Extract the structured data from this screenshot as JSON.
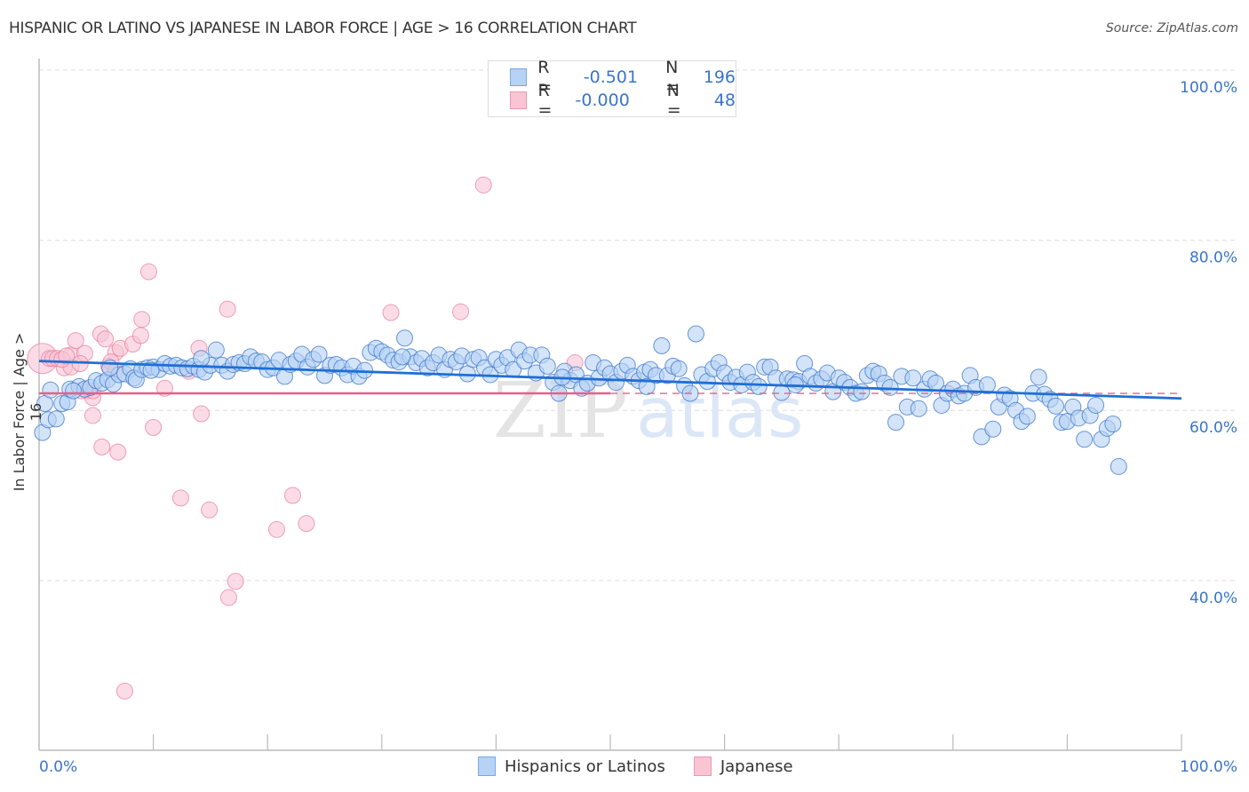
{
  "title": "HISPANIC OR LATINO VS JAPANESE IN LABOR FORCE | AGE > 16 CORRELATION CHART",
  "source": "Source: ZipAtlas.com",
  "colors": {
    "blue": "#3a74c9",
    "blue_fill": "#b6d2f5",
    "blue_line": "#1f6fd6",
    "pink": "#e8799b",
    "pink_fill": "#f9c5d5",
    "pink_line": "#e5608a",
    "grid": "#dddddd",
    "axis": "#bbbbbb"
  },
  "legend_top": [
    {
      "r_label": "R =",
      "r_value": "-0.501",
      "n_label": "N =",
      "n_value": "196"
    },
    {
      "r_label": "R =",
      "r_value": "-0.000",
      "n_label": "N =",
      "n_value": "48"
    }
  ],
  "chart_data": {
    "type": "scatter",
    "title": "HISPANIC OR LATINO VS JAPANESE IN LABOR FORCE | AGE > 16 CORRELATION CHART",
    "xlabel": "",
    "ylabel": "In Labor Force | Age > 16",
    "xlim": [
      0,
      100
    ],
    "ylim": [
      20,
      102
    ],
    "x_tick_labels": [
      "0.0%",
      "100.0%"
    ],
    "x_minor_ticks": [
      10,
      20,
      30,
      40,
      50,
      60,
      70,
      80,
      90,
      100
    ],
    "y_ticks": [
      100,
      80,
      60,
      40
    ],
    "y_tick_labels": [
      "100.0%",
      "80.0%",
      "60.0%",
      "40.0%"
    ],
    "grid": true,
    "legend_position": "bottom-center",
    "watermark": "ZIPatlas",
    "series": [
      {
        "name": "Hispanics or Latinos",
        "r": -0.501,
        "n": 196,
        "trend": {
          "x": [
            0,
            100
          ],
          "y": [
            65.8,
            61.4
          ]
        },
        "points": [
          [
            0.3,
            57.4
          ],
          [
            0.8,
            58.9
          ],
          [
            1.5,
            59.0
          ],
          [
            2.0,
            60.8
          ],
          [
            2.5,
            61.0
          ],
          [
            2.7,
            62.5
          ],
          [
            3.5,
            62.8
          ],
          [
            4.0,
            62.5
          ],
          [
            4.5,
            62.7
          ],
          [
            5.0,
            63.5
          ],
          [
            5.5,
            63.2
          ],
          [
            6.0,
            63.6
          ],
          [
            6.5,
            63.1
          ],
          [
            7.0,
            64.2
          ],
          [
            7.5,
            64.3
          ],
          [
            8.0,
            64.9
          ],
          [
            8.3,
            63.8
          ],
          [
            8.5,
            63.6
          ],
          [
            9.0,
            64.8
          ],
          [
            9.5,
            65.0
          ],
          [
            10.0,
            65.1
          ],
          [
            10.5,
            64.8
          ],
          [
            11.0,
            65.5
          ],
          [
            11.5,
            65.2
          ],
          [
            12.0,
            65.3
          ],
          [
            12.5,
            65.0
          ],
          [
            13.0,
            64.9
          ],
          [
            13.5,
            65.2
          ],
          [
            14.0,
            64.8
          ],
          [
            14.5,
            64.5
          ],
          [
            15.0,
            65.3
          ],
          [
            15.5,
            67.1
          ],
          [
            16.0,
            65.3
          ],
          [
            16.5,
            64.6
          ],
          [
            17.0,
            65.4
          ],
          [
            17.5,
            65.6
          ],
          [
            18.0,
            65.5
          ],
          [
            18.5,
            66.3
          ],
          [
            19.0,
            65.8
          ],
          [
            19.5,
            65.7
          ],
          [
            20.0,
            64.8
          ],
          [
            20.5,
            65.0
          ],
          [
            21.0,
            65.9
          ],
          [
            21.5,
            64.0
          ],
          [
            22.0,
            65.4
          ],
          [
            22.5,
            65.8
          ],
          [
            23.0,
            66.6
          ],
          [
            23.5,
            65.1
          ],
          [
            24.0,
            66.0
          ],
          [
            24.5,
            66.6
          ],
          [
            25.0,
            64.1
          ],
          [
            25.5,
            65.3
          ],
          [
            26.0,
            65.4
          ],
          [
            26.5,
            65.0
          ],
          [
            27.0,
            64.2
          ],
          [
            27.5,
            65.2
          ],
          [
            28.0,
            64.0
          ],
          [
            28.5,
            64.7
          ],
          [
            29.0,
            66.8
          ],
          [
            29.5,
            67.3
          ],
          [
            30.0,
            66.9
          ],
          [
            30.5,
            66.5
          ],
          [
            31.0,
            65.9
          ],
          [
            31.5,
            65.7
          ],
          [
            32.0,
            68.5
          ],
          [
            32.5,
            66.3
          ],
          [
            33.0,
            65.6
          ],
          [
            33.5,
            66.1
          ],
          [
            34.0,
            65.0
          ],
          [
            34.5,
            65.6
          ],
          [
            35.0,
            66.5
          ],
          [
            35.5,
            64.8
          ],
          [
            36.0,
            66.0
          ],
          [
            36.5,
            65.7
          ],
          [
            37.0,
            66.4
          ],
          [
            37.5,
            64.3
          ],
          [
            38.0,
            66.0
          ],
          [
            38.5,
            66.2
          ],
          [
            39.0,
            65.0
          ],
          [
            39.5,
            64.2
          ],
          [
            40.0,
            66.0
          ],
          [
            40.5,
            65.3
          ],
          [
            41.0,
            66.2
          ],
          [
            41.5,
            64.8
          ],
          [
            42.0,
            67.1
          ],
          [
            42.5,
            65.8
          ],
          [
            43.0,
            66.5
          ],
          [
            43.5,
            64.4
          ],
          [
            44.0,
            66.5
          ],
          [
            44.5,
            65.2
          ],
          [
            45.0,
            63.3
          ],
          [
            45.5,
            62.0
          ],
          [
            46.0,
            64.6
          ],
          [
            46.5,
            63.5
          ],
          [
            47.0,
            64.2
          ],
          [
            47.5,
            62.6
          ],
          [
            48.0,
            63.2
          ],
          [
            48.5,
            65.6
          ],
          [
            49.0,
            63.8
          ],
          [
            49.5,
            65.0
          ],
          [
            50.0,
            64.3
          ],
          [
            50.5,
            63.3
          ],
          [
            51.0,
            64.6
          ],
          [
            51.5,
            65.3
          ],
          [
            52.0,
            64.0
          ],
          [
            52.5,
            63.5
          ],
          [
            53.0,
            64.5
          ],
          [
            53.5,
            64.8
          ],
          [
            54.0,
            64.1
          ],
          [
            54.5,
            67.6
          ],
          [
            55.0,
            64.1
          ],
          [
            55.5,
            65.2
          ],
          [
            56.0,
            64.9
          ],
          [
            56.5,
            62.9
          ],
          [
            57.0,
            62.0
          ],
          [
            57.5,
            69.0
          ],
          [
            58.0,
            64.2
          ],
          [
            58.5,
            63.4
          ],
          [
            59.0,
            64.9
          ],
          [
            59.5,
            65.6
          ],
          [
            60.0,
            64.4
          ],
          [
            60.5,
            63.3
          ],
          [
            61.0,
            63.9
          ],
          [
            61.5,
            63.0
          ],
          [
            62.0,
            64.5
          ],
          [
            62.5,
            63.3
          ],
          [
            63.0,
            62.8
          ],
          [
            63.5,
            65.1
          ],
          [
            64.0,
            65.1
          ],
          [
            64.5,
            63.8
          ],
          [
            65.0,
            62.1
          ],
          [
            65.5,
            63.7
          ],
          [
            66.0,
            63.6
          ],
          [
            66.5,
            63.4
          ],
          [
            67.0,
            65.5
          ],
          [
            67.5,
            64.0
          ],
          [
            68.0,
            63.2
          ],
          [
            68.5,
            63.7
          ],
          [
            69.0,
            64.4
          ],
          [
            69.5,
            62.2
          ],
          [
            70.0,
            63.8
          ],
          [
            70.5,
            63.3
          ],
          [
            71.0,
            62.7
          ],
          [
            71.5,
            62.0
          ],
          [
            72.0,
            62.2
          ],
          [
            72.5,
            64.1
          ],
          [
            73.0,
            64.6
          ],
          [
            73.5,
            64.3
          ],
          [
            74.0,
            63.2
          ],
          [
            74.5,
            62.7
          ],
          [
            75.0,
            58.6
          ],
          [
            75.5,
            64.0
          ],
          [
            76.0,
            60.4
          ],
          [
            76.5,
            63.8
          ],
          [
            77.0,
            60.2
          ],
          [
            77.5,
            62.5
          ],
          [
            78.0,
            63.7
          ],
          [
            78.5,
            63.2
          ],
          [
            79.0,
            60.6
          ],
          [
            79.5,
            62.0
          ],
          [
            80.0,
            62.5
          ],
          [
            80.5,
            61.7
          ],
          [
            81.0,
            62.0
          ],
          [
            81.5,
            64.1
          ],
          [
            82.0,
            62.7
          ],
          [
            82.5,
            56.9
          ],
          [
            83.0,
            63.0
          ],
          [
            83.5,
            57.8
          ],
          [
            84.0,
            60.4
          ],
          [
            84.5,
            61.8
          ],
          [
            85.0,
            61.4
          ],
          [
            85.5,
            60.0
          ],
          [
            86.0,
            58.7
          ],
          [
            86.5,
            59.3
          ],
          [
            87.0,
            62.0
          ],
          [
            87.5,
            63.9
          ],
          [
            88.0,
            61.9
          ],
          [
            88.5,
            61.3
          ],
          [
            89.0,
            60.5
          ],
          [
            89.5,
            58.6
          ],
          [
            90.0,
            58.7
          ],
          [
            90.5,
            60.4
          ],
          [
            91.0,
            59.1
          ],
          [
            91.5,
            56.6
          ],
          [
            92.0,
            59.4
          ],
          [
            92.5,
            60.6
          ],
          [
            93.0,
            56.6
          ],
          [
            93.5,
            57.9
          ],
          [
            94.0,
            58.4
          ],
          [
            94.5,
            53.4
          ],
          [
            0.5,
            60.8
          ],
          [
            1.0,
            62.4
          ],
          [
            3.0,
            62.3
          ],
          [
            6.2,
            65.0
          ],
          [
            9.8,
            64.7
          ],
          [
            14.2,
            66.1
          ],
          [
            31.8,
            66.3
          ],
          [
            45.8,
            63.9
          ],
          [
            53.2,
            62.8
          ],
          [
            66.2,
            63.0
          ]
        ]
      },
      {
        "name": "Japanese",
        "r": -0.0,
        "n": 48,
        "trend": {
          "x": [
            0,
            50
          ],
          "y": [
            62.0,
            62.0
          ],
          "dashed_extension": {
            "x": [
              50,
              100
            ],
            "y": [
              62.0,
              62.0
            ]
          }
        },
        "points": [
          [
            0.3,
            66.1
          ],
          [
            0.9,
            66.1
          ],
          [
            1.2,
            66.1
          ],
          [
            1.6,
            66.1
          ],
          [
            2.2,
            65.0
          ],
          [
            2.8,
            66.5
          ],
          [
            3.2,
            68.2
          ],
          [
            2.8,
            65.1
          ],
          [
            4.0,
            66.7
          ],
          [
            4.2,
            62.3
          ],
          [
            4.7,
            61.5
          ],
          [
            4.7,
            59.4
          ],
          [
            5.4,
            69.0
          ],
          [
            5.5,
            55.7
          ],
          [
            6.1,
            65.2
          ],
          [
            6.7,
            66.8
          ],
          [
            6.9,
            55.1
          ],
          [
            7.1,
            67.3
          ],
          [
            7.5,
            27.0
          ],
          [
            8.2,
            67.8
          ],
          [
            8.9,
            68.8
          ],
          [
            9.0,
            70.7
          ],
          [
            9.6,
            76.3
          ],
          [
            10.0,
            58.0
          ],
          [
            11.0,
            62.6
          ],
          [
            12.4,
            49.7
          ],
          [
            13.1,
            64.6
          ],
          [
            14.0,
            67.3
          ],
          [
            14.2,
            59.6
          ],
          [
            14.9,
            48.3
          ],
          [
            16.5,
            71.9
          ],
          [
            16.6,
            38.0
          ],
          [
            17.2,
            39.9
          ],
          [
            20.8,
            46.0
          ],
          [
            22.2,
            50.0
          ],
          [
            23.4,
            46.7
          ],
          [
            30.8,
            71.5
          ],
          [
            36.9,
            71.6
          ],
          [
            38.9,
            86.5
          ],
          [
            46.9,
            65.6
          ],
          [
            3.6,
            65.5
          ],
          [
            6.3,
            65.7
          ],
          [
            2.0,
            66.0
          ],
          [
            2.4,
            66.4
          ],
          [
            6.7,
            64.6
          ],
          [
            4.7,
            62.3
          ],
          [
            5.8,
            68.4
          ],
          [
            3.7,
            62.3
          ]
        ]
      }
    ]
  },
  "bottom_legend": [
    {
      "label": "Hispanics or Latinos"
    },
    {
      "label": "Japanese"
    }
  ]
}
